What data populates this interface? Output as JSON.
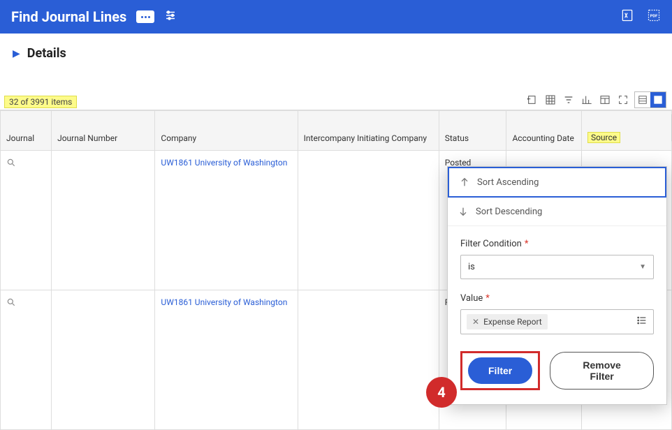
{
  "header": {
    "title": "Find Journal Lines"
  },
  "details": {
    "label": "Details"
  },
  "count_text": "32 of 3991 items",
  "columns": {
    "journal": "Journal",
    "journal_number": "Journal Number",
    "company": "Company",
    "intercompany": "Intercompany Initiating Company",
    "status": "Status",
    "accounting_date": "Accounting Date",
    "source": "Source"
  },
  "rows": [
    {
      "company": "UW1861 University of Washington",
      "status": "Posted"
    },
    {
      "company": "UW1861 University of Washington",
      "status": "Posted"
    }
  ],
  "filter": {
    "sort_asc": "Sort Ascending",
    "sort_desc": "Sort Descending",
    "condition_label": "Filter Condition",
    "condition_value": "is",
    "value_label": "Value",
    "chip": "Expense Report",
    "btn_filter": "Filter",
    "btn_remove": "Remove Filter"
  },
  "step": "4"
}
